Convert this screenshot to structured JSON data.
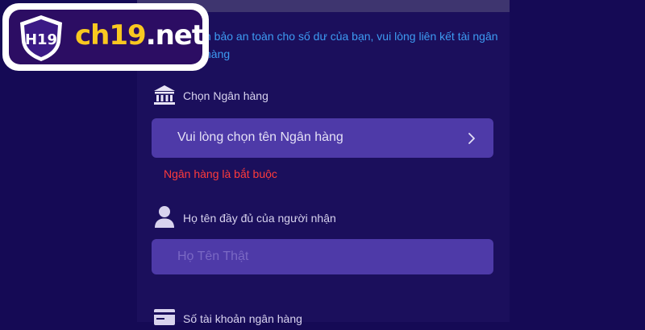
{
  "logo": {
    "badge": "H19",
    "brand_prefix": "ch19",
    "brand_suffix": ".net"
  },
  "notice": "n bảo an toàn cho số dư của bạn, vui lòng liên kết tài ngân hàng",
  "bank_section": {
    "label": "Chọn Ngân hàng",
    "icon": "bank-icon",
    "select_placeholder": "Vui lòng chọn tên Ngân hàng",
    "error": "Ngân hàng là bắt buộc"
  },
  "name_section": {
    "label": "Họ tên đầy đủ của người nhận",
    "icon": "user-icon",
    "input_placeholder": "Họ Tên Thật"
  },
  "account_section": {
    "label": "Số tài khoản ngân hàng",
    "icon": "card-icon"
  },
  "colors": {
    "background": "#150a55",
    "panel": "#1b0f5c",
    "field": "#4e3aa8",
    "notice_text": "#3d9bf2",
    "error_text": "#ff3b3b",
    "brand_yellow": "#f9c820",
    "brand_purple": "#2c0d63"
  }
}
